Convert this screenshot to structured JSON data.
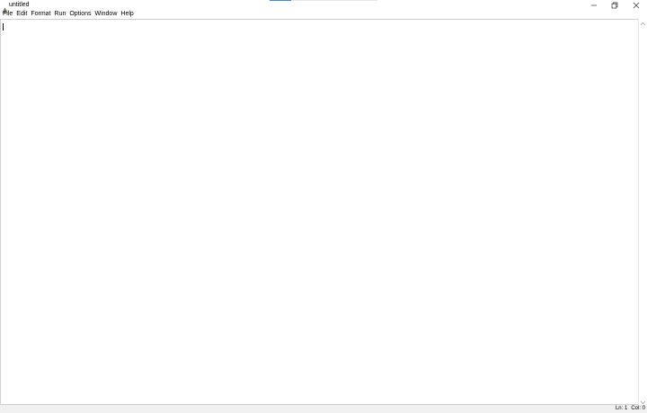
{
  "window": {
    "title": "untitled",
    "title_progress": 0.2,
    "colors": {
      "progress_accent": "#3d8fd6",
      "background": "#ffffff"
    }
  },
  "titlebar": {
    "app_icon": "python-idle-icon",
    "buttons": {
      "minimize_icon": "minimize-icon",
      "restore_icon": "restore-icon",
      "close_icon": "close-icon"
    }
  },
  "menubar": {
    "items": [
      "File",
      "Edit",
      "Format",
      "Run",
      "Options",
      "Window",
      "Help"
    ]
  },
  "editor": {
    "content": ""
  },
  "statusbar": {
    "line": "Ln: 1",
    "col": "Col: 0"
  }
}
